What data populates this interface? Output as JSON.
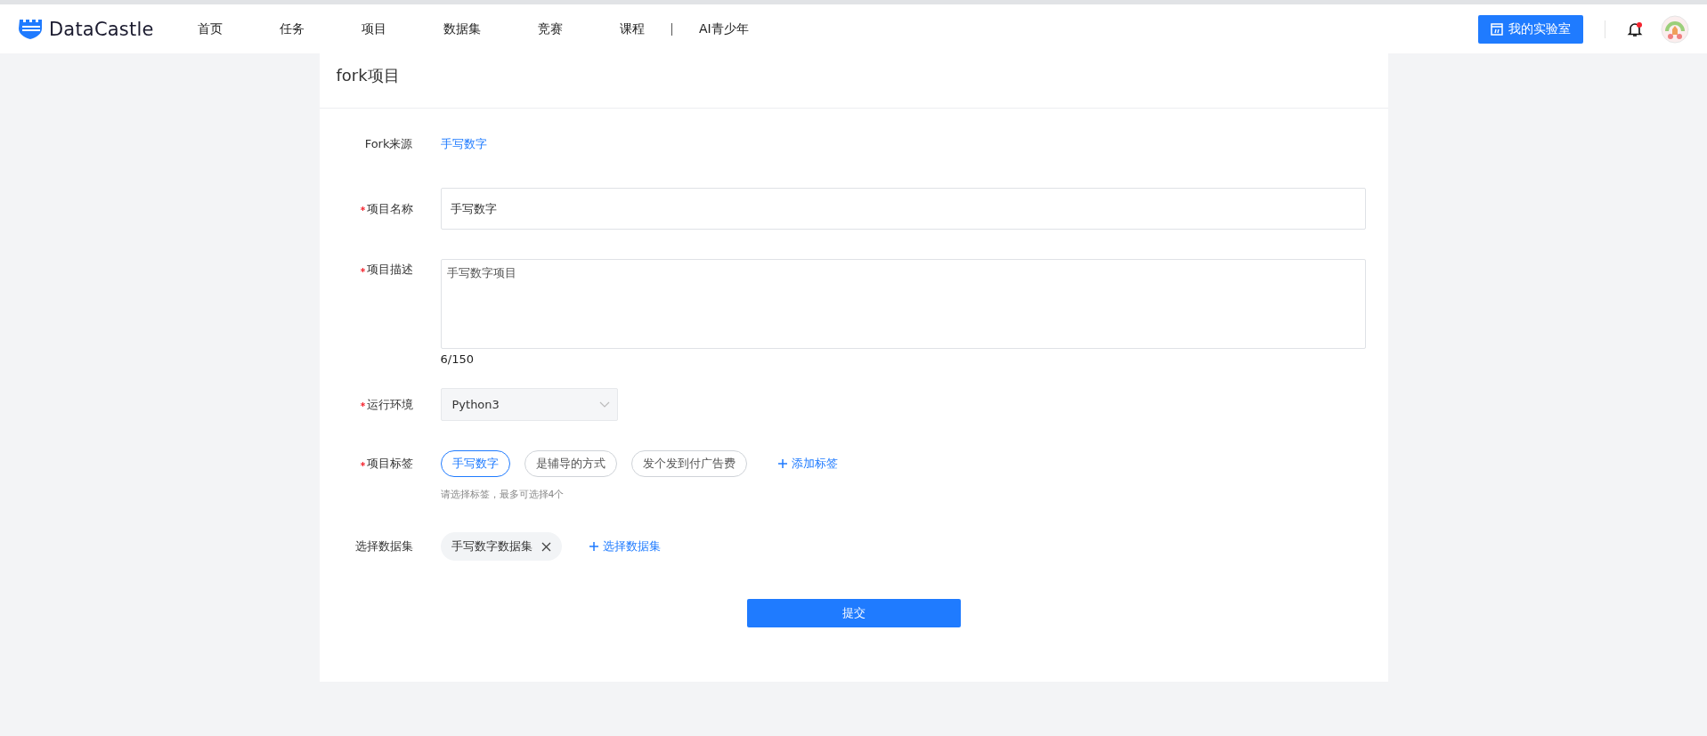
{
  "header": {
    "logo": "DataCastle",
    "nav": [
      {
        "label": "首页"
      },
      {
        "label": "任务"
      },
      {
        "label": "项目"
      },
      {
        "label": "数据集"
      },
      {
        "label": "竞赛"
      },
      {
        "label": "课程"
      },
      {
        "label": "AI青少年"
      }
    ],
    "lab_button": "我的实验室",
    "notification": true
  },
  "card": {
    "title": "fork项目",
    "rows": [
      {
        "kind": "link",
        "label": "Fork来源",
        "required": false,
        "value": "手写数字"
      },
      {
        "kind": "input",
        "label": "项目名称",
        "required": true,
        "value": "手写数字"
      },
      {
        "kind": "textarea",
        "label": "项目描述",
        "required": true,
        "value": "手写数字项目",
        "count": "6/150"
      },
      {
        "kind": "select",
        "label": "运行环境",
        "required": true,
        "value": "Python3"
      },
      {
        "kind": "tags",
        "label": "项目标签",
        "required": true,
        "tags": [
          {
            "label": "手写数字",
            "selected": true
          },
          {
            "label": "是辅导的方式",
            "selected": false
          },
          {
            "label": "发个发到付广告费",
            "selected": false
          }
        ],
        "add": "添加标签",
        "hint": "请选择标签，最多可选择4个"
      },
      {
        "kind": "datasets",
        "label": "选择数据集",
        "required": false,
        "items": [
          "手写数字数据集"
        ],
        "add": "选择数据集"
      }
    ],
    "submit": "提交"
  }
}
